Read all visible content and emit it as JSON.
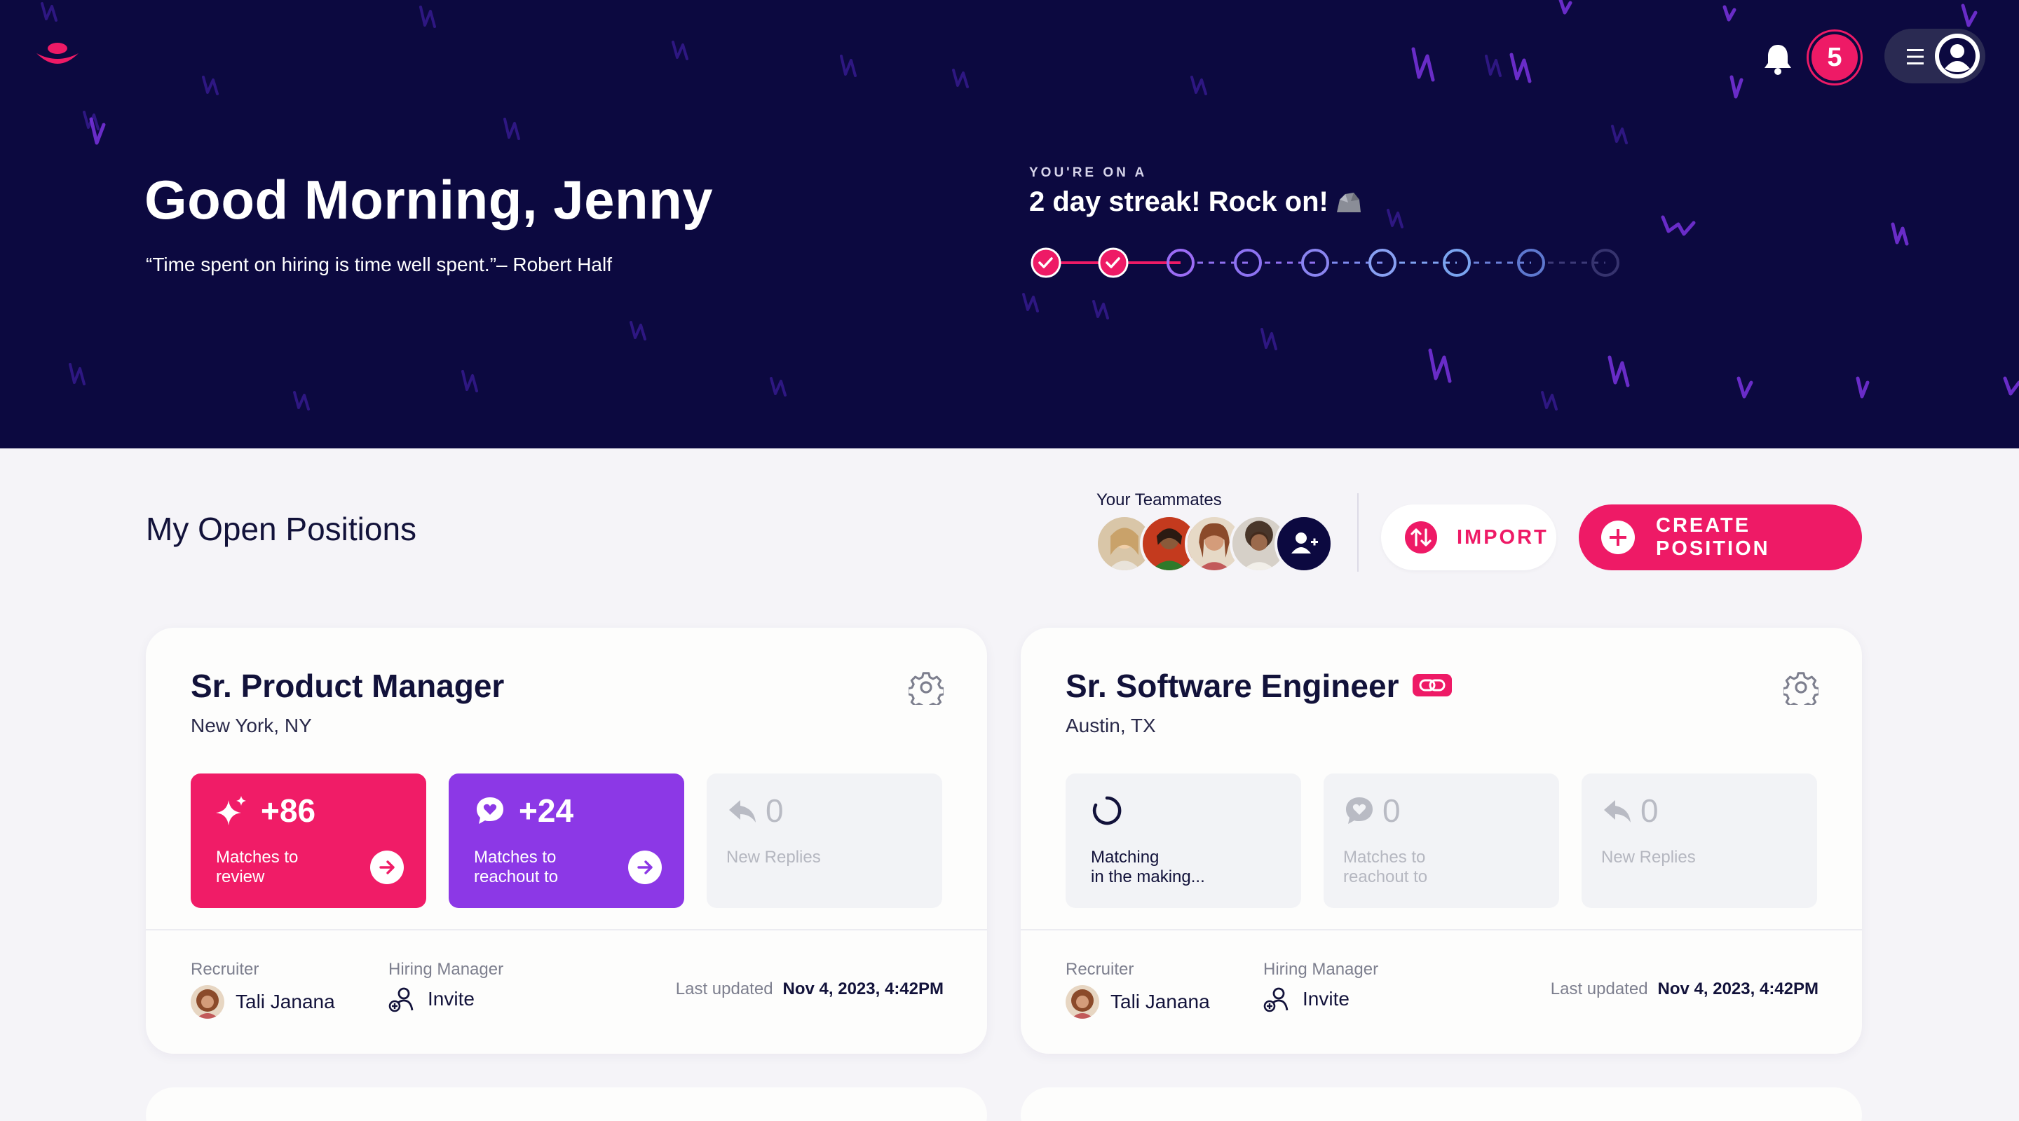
{
  "header": {
    "notification_count": "5",
    "greeting": "Good Morning, Jenny",
    "quote": "“Time spent on hiring is time well spent.”– Robert Half",
    "streak_kicker": "YOU'RE ON A",
    "streak_title": "2 day streak! Rock on!",
    "streak_days_completed": 2,
    "streak_days_total": 9
  },
  "positions_section": {
    "title": "My Open Positions",
    "teammates_label": "Your Teammates",
    "import_label": "IMPORT",
    "create_label": "CREATE POSITION"
  },
  "cards": [
    {
      "title": "Sr. Product Manager",
      "location": "New York, NY",
      "stats": [
        {
          "value": "+86",
          "label_line1": "Matches to",
          "label_line2": "review"
        },
        {
          "value": "+24",
          "label_line1": "Matches to",
          "label_line2": "reachout to"
        },
        {
          "value": "0",
          "label_line1": "New Replies",
          "label_line2": ""
        }
      ],
      "recruiter_label": "Recruiter",
      "recruiter_name": "Tali Janana",
      "manager_label": "Hiring Manager",
      "manager_value": "Invite",
      "updated_label": "Last updated",
      "updated_value": "Nov 4, 2023, 4:42PM"
    },
    {
      "title": "Sr. Software Engineer",
      "location": "Austin, TX",
      "stats": [
        {
          "value": "",
          "label_line1": "Matching",
          "label_line2": "in the making..."
        },
        {
          "value": "0",
          "label_line1": "Matches to",
          "label_line2": "reachout to"
        },
        {
          "value": "0",
          "label_line1": "New Replies",
          "label_line2": ""
        }
      ],
      "recruiter_label": "Recruiter",
      "recruiter_name": "Tali Janana",
      "manager_label": "Hiring Manager",
      "manager_value": "Invite",
      "updated_label": "Last updated",
      "updated_value": "Nov 4, 2023, 4:42PM"
    }
  ],
  "colors": {
    "hero_bg": "#0c0940",
    "accent_pink": "#ee1a66",
    "accent_purple": "#8c38e6",
    "squiggle": "#5b2bd0"
  },
  "icons": [
    "logo-icon",
    "bell-icon",
    "hamburger-icon",
    "user-avatar-icon",
    "rock-icon",
    "add-teammate-icon",
    "import-icon",
    "plus-icon",
    "gear-icon",
    "link-icon",
    "sparkle-icon",
    "chat-heart-icon",
    "reply-icon",
    "loading-icon",
    "arrow-right-icon",
    "invite-user-icon"
  ]
}
